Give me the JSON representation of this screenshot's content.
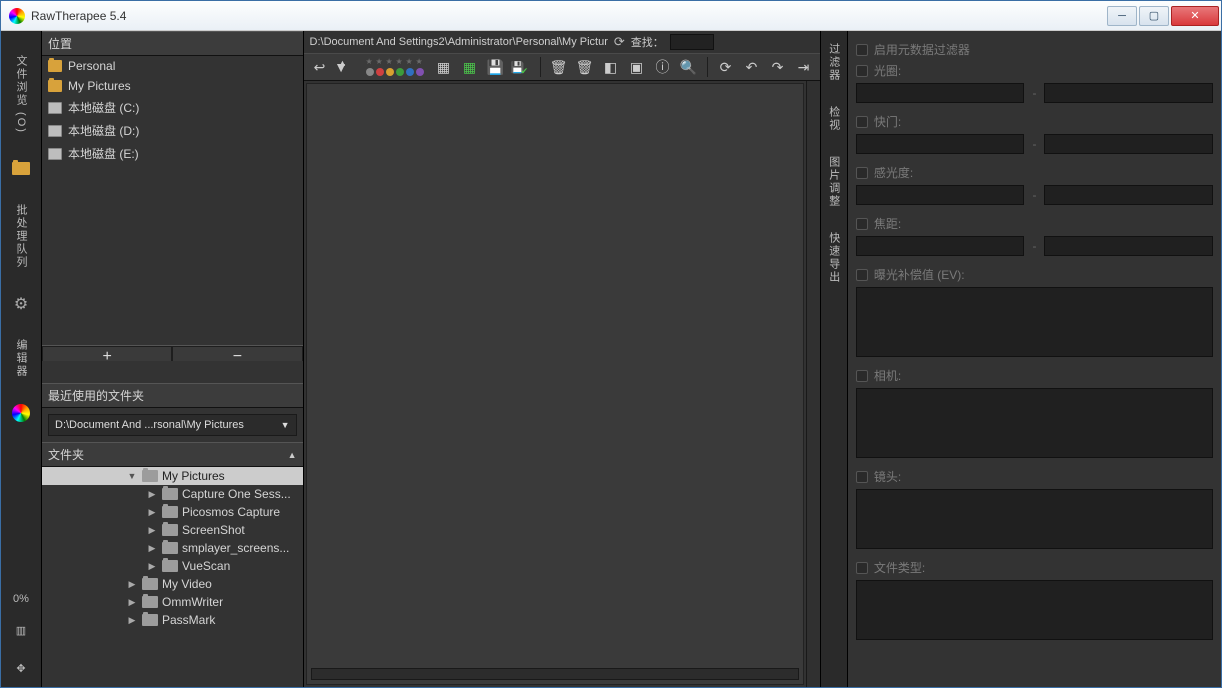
{
  "window": {
    "title": "RawTherapee 5.4"
  },
  "leftbar": {
    "tab_filebrowser": "文件浏览 (O)",
    "tab_queue": "批处理队列",
    "tab_editor": "编辑器",
    "zoom_pct": "0%"
  },
  "places": {
    "header": "位置",
    "items": [
      {
        "label": "Personal",
        "kind": "folder"
      },
      {
        "label": "My Pictures",
        "kind": "folder"
      },
      {
        "label": "本地磁盘 (C:)",
        "kind": "disk"
      },
      {
        "label": "本地磁盘 (D:)",
        "kind": "disk"
      },
      {
        "label": "本地磁盘 (E:)",
        "kind": "disk"
      }
    ],
    "add": "+",
    "remove": "−"
  },
  "recent": {
    "header": "最近使用的文件夹",
    "selected": "D:\\Document And ...rsonal\\My Pictures"
  },
  "tree": {
    "header": "文件夹",
    "root": "My Pictures",
    "children": [
      "Capture One Sess...",
      "Picosmos Capture",
      "ScreenShot",
      "smplayer_screens...",
      "VueScan"
    ],
    "siblings": [
      "My Video",
      "OmmWriter",
      "PassMark"
    ]
  },
  "center": {
    "path": "D:\\Document And Settings2\\Administrator\\Personal\\My Pictur",
    "search_label": "查找：",
    "search_value": ""
  },
  "rtabs": {
    "filter": "过滤器",
    "inspect": "检视",
    "batch": "图片调整",
    "export": "快速导出"
  },
  "filter": {
    "enable_meta": "启用元数据过滤器",
    "aperture": "光圈:",
    "shutter": "快门:",
    "iso": "感光度:",
    "focal": "焦距:",
    "ev": "曝光补偿值 (EV):",
    "camera": "相机:",
    "lens": "镜头:",
    "filetype": "文件类型:"
  },
  "star_colors": [
    "#888888",
    "#d04040",
    "#d8a030",
    "#3c9c3c",
    "#3070c0",
    "#8050b0"
  ]
}
